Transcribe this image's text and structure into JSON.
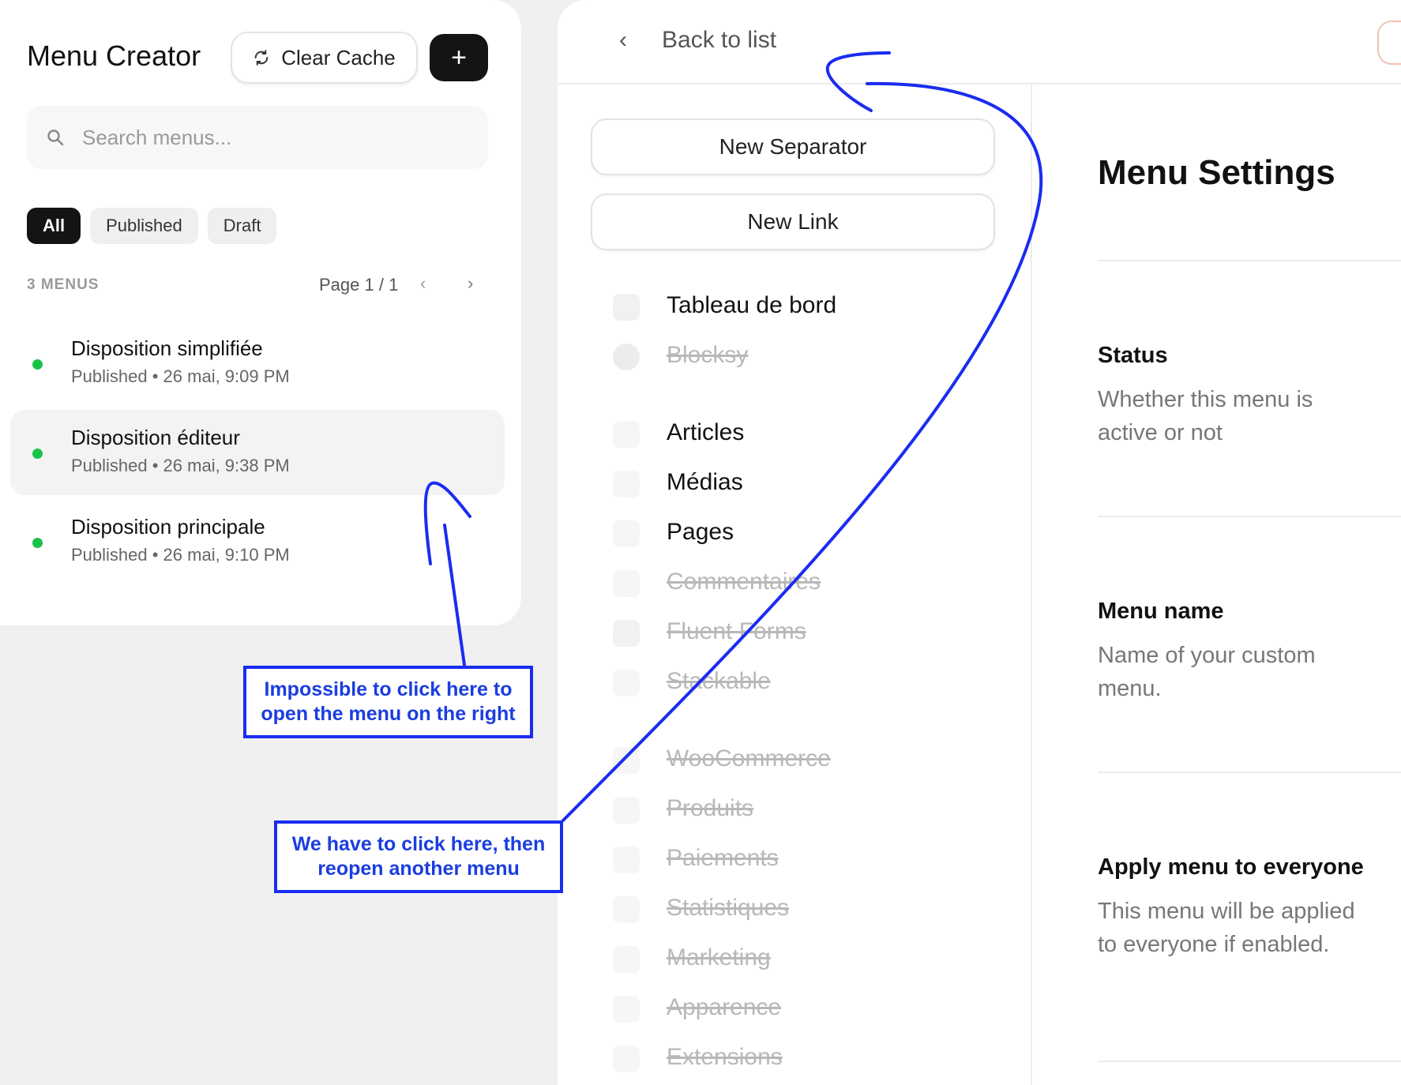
{
  "sidebar": {
    "title": "Menu Creator",
    "clear_cache_label": "Clear Cache",
    "add_label": "+",
    "search_placeholder": "Search menus...",
    "filters": [
      {
        "label": "All",
        "active": true
      },
      {
        "label": "Published",
        "active": false
      },
      {
        "label": "Draft",
        "active": false
      }
    ],
    "count_label": "3 MENUS",
    "page_label": "Page 1 / 1",
    "prev_label": "‹",
    "next_label": "›",
    "menus": [
      {
        "name": "Disposition simplifiée",
        "meta": "Published • 26 mai, 9:09 PM",
        "status_color": "#1bc24a"
      },
      {
        "name": "Disposition éditeur",
        "meta": "Published • 26 mai, 9:38 PM",
        "status_color": "#1bc24a"
      },
      {
        "name": "Disposition principale",
        "meta": "Published • 26 mai, 9:10 PM",
        "status_color": "#1bc24a"
      }
    ]
  },
  "editor": {
    "back_arrow": "‹",
    "back_label": "Back to list",
    "new_separator_label": "New Separator",
    "new_link_label": "New Link",
    "items": [
      {
        "label": "Tableau de bord",
        "disabled": false,
        "icon": "dashboard-icon"
      },
      {
        "label": "Blocksy",
        "disabled": true,
        "icon": "blocksy-icon"
      },
      {
        "label": "Articles",
        "disabled": false,
        "icon": "document-icon"
      },
      {
        "label": "Médias",
        "disabled": false,
        "icon": "image-icon"
      },
      {
        "label": "Pages",
        "disabled": false,
        "icon": "page-icon"
      },
      {
        "label": "Commentaires",
        "disabled": true,
        "icon": "comment-icon"
      },
      {
        "label": "Fluent Forms",
        "disabled": true,
        "icon": "form-icon"
      },
      {
        "label": "Stackable",
        "disabled": true,
        "icon": "stackable-icon"
      },
      {
        "label": "WooCommerce",
        "disabled": true,
        "icon": "woocommerce-icon"
      },
      {
        "label": "Produits",
        "disabled": true,
        "icon": "product-icon"
      },
      {
        "label": "Paiements",
        "disabled": true,
        "icon": "payment-icon"
      },
      {
        "label": "Statistiques",
        "disabled": true,
        "icon": "chart-icon"
      },
      {
        "label": "Marketing",
        "disabled": true,
        "icon": "marketing-icon"
      },
      {
        "label": "Apparence",
        "disabled": true,
        "icon": "brush-icon"
      },
      {
        "label": "Extensions",
        "disabled": true,
        "icon": "plugin-icon"
      }
    ]
  },
  "settings": {
    "title": "Menu Settings",
    "sections": [
      {
        "heading": "Status",
        "description": "Whether this menu is active or not"
      },
      {
        "heading": "Menu name",
        "description": "Name of your custom menu."
      },
      {
        "heading": "Apply menu to everyone",
        "description": "This menu will be applied to everyone if enabled."
      }
    ]
  },
  "annotations": {
    "note_1": "Impossible to click here to open the menu on the right",
    "note_2": "We have to click here, then reopen another menu",
    "color": "#1a2cf0"
  }
}
